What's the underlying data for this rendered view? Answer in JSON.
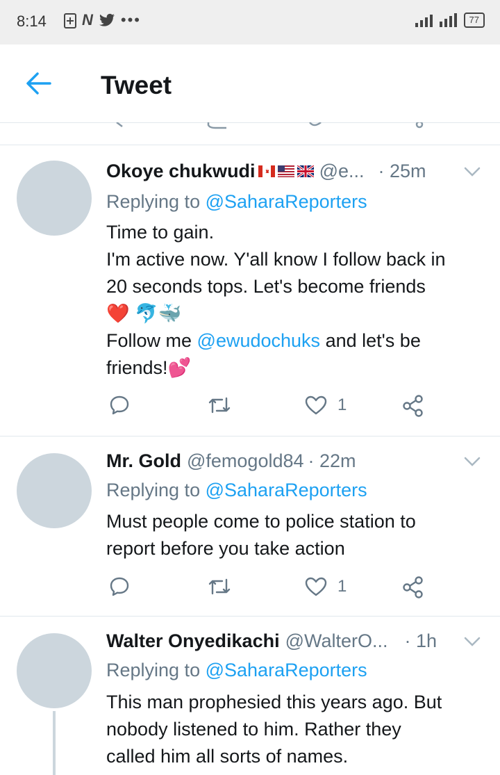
{
  "status_bar": {
    "time": "8:14",
    "battery": "77"
  },
  "app_bar": {
    "title": "Tweet"
  },
  "tweets": [
    {
      "name": "Okoye chukwudi",
      "handle": "@e...",
      "time": "· 25m",
      "replying_label": "Replying to",
      "replying_to": "@SaharaReporters",
      "lines": [
        "Time to gain.",
        "I'm active now. Y'all know I follow back in",
        "20 seconds tops. Let's become friends",
        "❤️ 🐬🐳"
      ],
      "follow_prefix": "Follow me",
      "follow_mention": "@ewudochuks",
      "follow_suffix": "and let's be",
      "last_line": "friends!💕",
      "likes": "1"
    },
    {
      "name": "Mr. Gold",
      "handle": "@femogold84",
      "time": "· 22m",
      "replying_label": "Replying to",
      "replying_to": "@SaharaReporters",
      "lines": [
        "Must people come to police station to",
        "report before you take action"
      ],
      "likes": "1"
    },
    {
      "name": "Walter Onyedikachi",
      "handle": "@WalterO...",
      "time": "· 1h",
      "replying_label": "Replying to",
      "replying_to": "@SaharaReporters",
      "lines": [
        "This man prophesied this years ago. But",
        "nobody listened to him. Rather they",
        "called him all sorts of names."
      ]
    }
  ],
  "colors": {
    "accent": "#1da1f2",
    "muted": "#657786",
    "avatar": "#ccd6dd"
  },
  "icons": [
    "back-arrow-icon",
    "reply-icon",
    "retweet-icon",
    "like-icon",
    "share-icon",
    "chevron-down-icon"
  ]
}
